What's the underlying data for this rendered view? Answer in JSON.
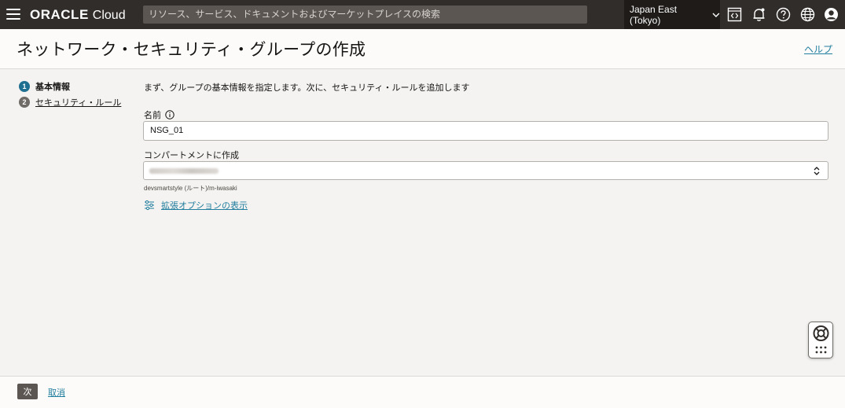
{
  "topbar": {
    "logo_brand": "ORACLE",
    "logo_product": "Cloud",
    "search_placeholder": "リソース、サービス、ドキュメントおよびマーケットプレイスの検索",
    "region": "Japan East (Tokyo)",
    "icons": [
      "menu-icon",
      "code-editor-icon",
      "bell-icon",
      "help-icon",
      "globe-icon",
      "user-icon"
    ]
  },
  "header": {
    "title": "ネットワーク・セキュリティ・グループの作成",
    "help": "ヘルプ"
  },
  "steps": [
    {
      "num": "1",
      "label": "基本情報"
    },
    {
      "num": "2",
      "label": "セキュリティ・ルール"
    }
  ],
  "form": {
    "intro": "まず、グループの基本情報を指定します。次に、セキュリティ・ルールを追加します",
    "name_label": "名前",
    "name_value": "NSG_01",
    "compartment_label": "コンパートメントに作成",
    "compartment_path": "devsmartstyle (ルート)/m-iwasaki",
    "advanced_link": "拡張オプションの表示"
  },
  "footer": {
    "next": "次",
    "cancel": "取消"
  },
  "colors": {
    "topbar": "#312d2a",
    "region_bg": "#1e1b19",
    "link": "#227e9e",
    "step_active": "#1f6f91",
    "button": "#5b5652"
  }
}
